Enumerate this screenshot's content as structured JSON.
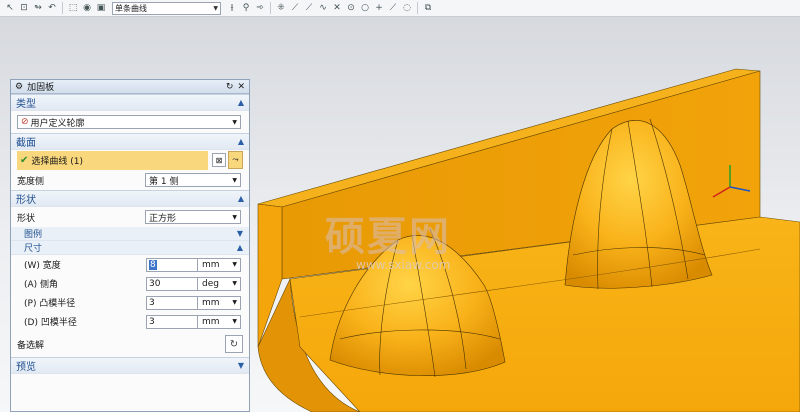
{
  "toolbar": {
    "curve_rule_value": "单条曲线"
  },
  "dialog": {
    "title": "加固板",
    "sections": {
      "type": {
        "label": "类型",
        "selected": "用户定义轮廓"
      },
      "section": {
        "label": "截面",
        "select_curve_label": "选择曲线 (1)",
        "width_side_label": "宽度侧",
        "width_side_value": "第 1 侧"
      },
      "shape": {
        "label": "形状",
        "shape_label": "形状",
        "shape_value": "正方形",
        "legend_label": "图例",
        "size_label": "尺寸",
        "dimensions": [
          {
            "label": "(W) 宽度",
            "value": "8",
            "unit": "mm"
          },
          {
            "label": "(A) 侧角",
            "value": "30",
            "unit": "deg"
          },
          {
            "label": "(P) 凸模半径",
            "value": "3",
            "unit": "mm"
          },
          {
            "label": "(D) 凹模半径",
            "value": "3",
            "unit": "mm"
          }
        ],
        "alternate_solution_label": "备选解"
      },
      "preview": {
        "label": "预览"
      }
    }
  },
  "watermark": {
    "text": "硕夏网",
    "url": "www.sxiaw.com"
  },
  "colors": {
    "part_body": "#f5a70a",
    "part_shadow": "#d98b00",
    "part_highlight": "#ffc830",
    "selection_highlight": "#f9d77c",
    "section_header_text": "#1f4f8f"
  }
}
